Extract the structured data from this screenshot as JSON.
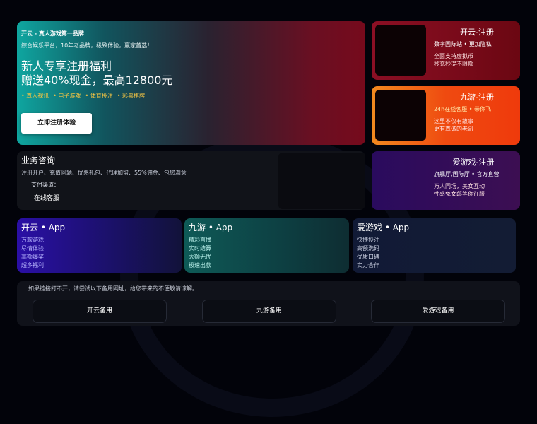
{
  "hero": {
    "brand_line": "开云 - 真人游戏第一品牌",
    "tagline": "综合娱乐平台，10年老品牌，极致体验，赢家首选！",
    "headline_1": "新人专享注册福利",
    "headline_2": "赠送40%现金，最高12800元",
    "features": [
      "• 真人视讯",
      "• 电子游戏",
      "• 体育投注",
      "• 彩票棋牌"
    ],
    "cta_label": "立即注册体验"
  },
  "promos": [
    {
      "title": "开云-注册",
      "subtitle": "数字国际站 • 更加隐私",
      "line1": "全面支持虚拟币",
      "line2": "秒充秒提不限额"
    },
    {
      "title": "九游-注册",
      "subtitle": "24h在线客服 • 带你飞",
      "line1": "这里不仅有故事",
      "line2": "更有真诚的老哥"
    },
    {
      "title": "爱游戏-注册",
      "subtitle": "旗舰厅/国际厅 • 官方直营",
      "line1": "万人同场，美女互动",
      "line2": "性感兔女郎等你征服"
    }
  ],
  "consult": {
    "heading": "业务咨询",
    "desc": "注册开户、充值问题、优惠礼包、代理加盟、55%佣金、包您满意",
    "payment": "支付渠道：",
    "service": "在线客服"
  },
  "apps": [
    {
      "title": "开云 • App",
      "features": [
        "万款游戏",
        "尽情体验",
        "高额爆奖",
        "超多福利"
      ]
    },
    {
      "title": "九游 • App",
      "features": [
        "精彩直播",
        "实时结算",
        "大额无忧",
        "极速出款"
      ]
    },
    {
      "title": "爱游戏 • App",
      "features": [
        "快捷投注",
        "高额洗码",
        "优质口碑",
        "实力合作"
      ]
    }
  ],
  "backup": {
    "note": "如果链接打不开，请尝试以下备用网址，给您带来的不便敬请谅解。",
    "buttons": [
      "开云备用",
      "九游备用",
      "爱游戏备用"
    ]
  }
}
